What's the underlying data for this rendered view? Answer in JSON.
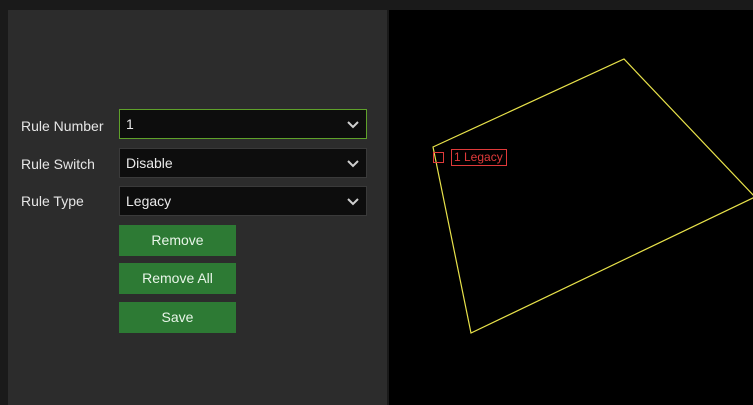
{
  "form": {
    "rule_number_label": "Rule Number",
    "rule_number_value": "1",
    "rule_switch_label": "Rule Switch",
    "rule_switch_value": "Disable",
    "rule_type_label": "Rule Type",
    "rule_type_value": "Legacy"
  },
  "buttons": {
    "remove": "Remove",
    "remove_all": "Remove All",
    "save": "Save"
  },
  "preview": {
    "region_label": "1 Legacy"
  },
  "colors": {
    "accent_green": "#2d7a34",
    "region_outline": "#e8e24a",
    "region_label": "#e03a3a"
  },
  "icons": {
    "dropdown": "chevron-down-icon",
    "handle": "square-handle-icon"
  }
}
